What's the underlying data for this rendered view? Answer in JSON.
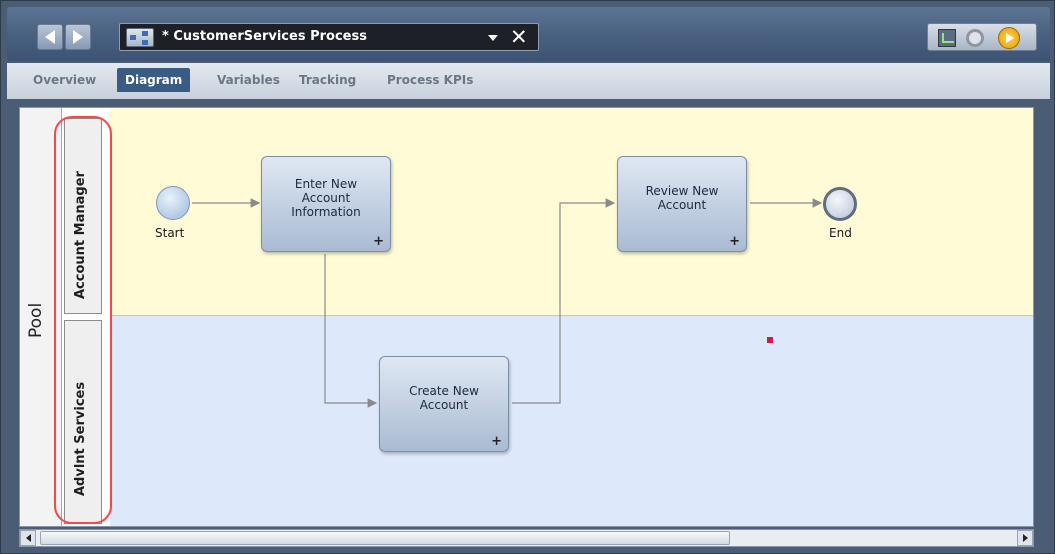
{
  "window": {
    "document_title": "* CustomerServices Process",
    "icons": [
      "back-arrow-icon",
      "forward-arrow-icon",
      "process-diagram-icon",
      "chevron-down-icon",
      "close-icon",
      "chart-icon",
      "gears-icon",
      "run-icon"
    ]
  },
  "tabs": [
    {
      "label": "Overview",
      "active": false
    },
    {
      "label": "Diagram",
      "active": true
    },
    {
      "label": "Variables",
      "active": false
    },
    {
      "label": "Tracking",
      "active": false
    },
    {
      "label": "Process KPIs",
      "active": false
    }
  ],
  "diagram": {
    "pool_label": "Pool",
    "lanes": [
      {
        "label": "Account Manager",
        "color": "#fffbd6"
      },
      {
        "label": "Advlnt Services",
        "color": "#dde9fb"
      }
    ],
    "events": {
      "start": "Start",
      "end": "End"
    },
    "tasks": {
      "enter_info": "Enter New Account Information",
      "create_account": "Create New Account",
      "review_account": "Review New Account"
    },
    "task_expand_symbol": "+",
    "highlight_color": "#ff4444"
  }
}
